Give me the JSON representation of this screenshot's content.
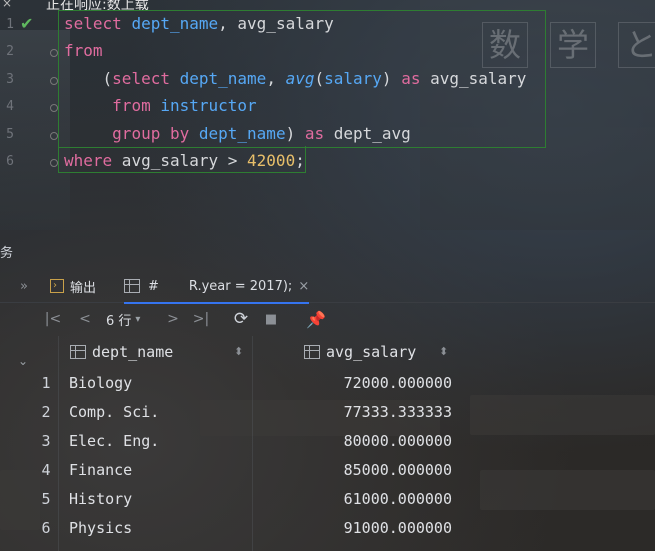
{
  "top": {
    "status_text": "正在响应:数上载",
    "close_glyph": "×"
  },
  "editor": {
    "line_numbers": [
      "1",
      "2",
      "3",
      "4",
      "5",
      "6"
    ],
    "lines": [
      {
        "tokens": [
          [
            "kw2",
            "select"
          ],
          [
            "plain",
            " "
          ],
          [
            "ident",
            "dept_name"
          ],
          [
            "plain",
            ", avg_salary"
          ]
        ]
      },
      {
        "tokens": [
          [
            "kw2",
            "from"
          ]
        ]
      },
      {
        "tokens": [
          [
            "plain",
            "    ("
          ],
          [
            "kw2",
            "select"
          ],
          [
            "plain",
            " "
          ],
          [
            "ident",
            "dept_name"
          ],
          [
            "plain",
            ", "
          ],
          [
            "fn",
            "avg"
          ],
          [
            "plain",
            "("
          ],
          [
            "ident",
            "salary"
          ],
          [
            "plain",
            ") "
          ],
          [
            "kw2",
            "as"
          ],
          [
            "plain",
            " avg_salary"
          ]
        ]
      },
      {
        "tokens": [
          [
            "plain",
            "     "
          ],
          [
            "kw2",
            "from"
          ],
          [
            "plain",
            " "
          ],
          [
            "ident",
            "instructor"
          ]
        ]
      },
      {
        "tokens": [
          [
            "plain",
            "     "
          ],
          [
            "kw2",
            "group by"
          ],
          [
            "plain",
            " "
          ],
          [
            "ident",
            "dept_name"
          ],
          [
            "plain",
            ") "
          ],
          [
            "kw2",
            "as"
          ],
          [
            "plain",
            " dept_avg"
          ]
        ]
      },
      {
        "tokens": [
          [
            "kw2",
            "where"
          ],
          [
            "plain",
            " avg_salary > "
          ],
          [
            "num",
            "42000"
          ],
          [
            "plain",
            ";"
          ]
        ]
      }
    ]
  },
  "board_glyphs": [
    "数",
    "学",
    "と"
  ],
  "side": {
    "label": "务"
  },
  "tabs": {
    "output_label": "输出",
    "grid_label": "#",
    "query_label": "R.year = 2017);",
    "close_glyph": "×"
  },
  "toolbar": {
    "rows_label": "6 行",
    "first": "|<",
    "prev": "<",
    "next": ">",
    "last": ">|"
  },
  "table": {
    "columns": [
      "dept_name",
      "avg_salary"
    ],
    "rows": [
      {
        "n": "1",
        "dept_name": "Biology",
        "avg_salary": "72000.000000"
      },
      {
        "n": "2",
        "dept_name": "Comp. Sci.",
        "avg_salary": "77333.333333"
      },
      {
        "n": "3",
        "dept_name": "Elec. Eng.",
        "avg_salary": "80000.000000"
      },
      {
        "n": "4",
        "dept_name": "Finance",
        "avg_salary": "85000.000000"
      },
      {
        "n": "5",
        "dept_name": "History",
        "avg_salary": "61000.000000"
      },
      {
        "n": "6",
        "dept_name": "Physics",
        "avg_salary": "91000.000000"
      }
    ]
  },
  "colors": {
    "keyword": "#e06c9f",
    "identifier": "#56a8f5",
    "number": "#e8bf6a",
    "selection_border": "#2e7d32",
    "tab_active": "#3574f0"
  }
}
